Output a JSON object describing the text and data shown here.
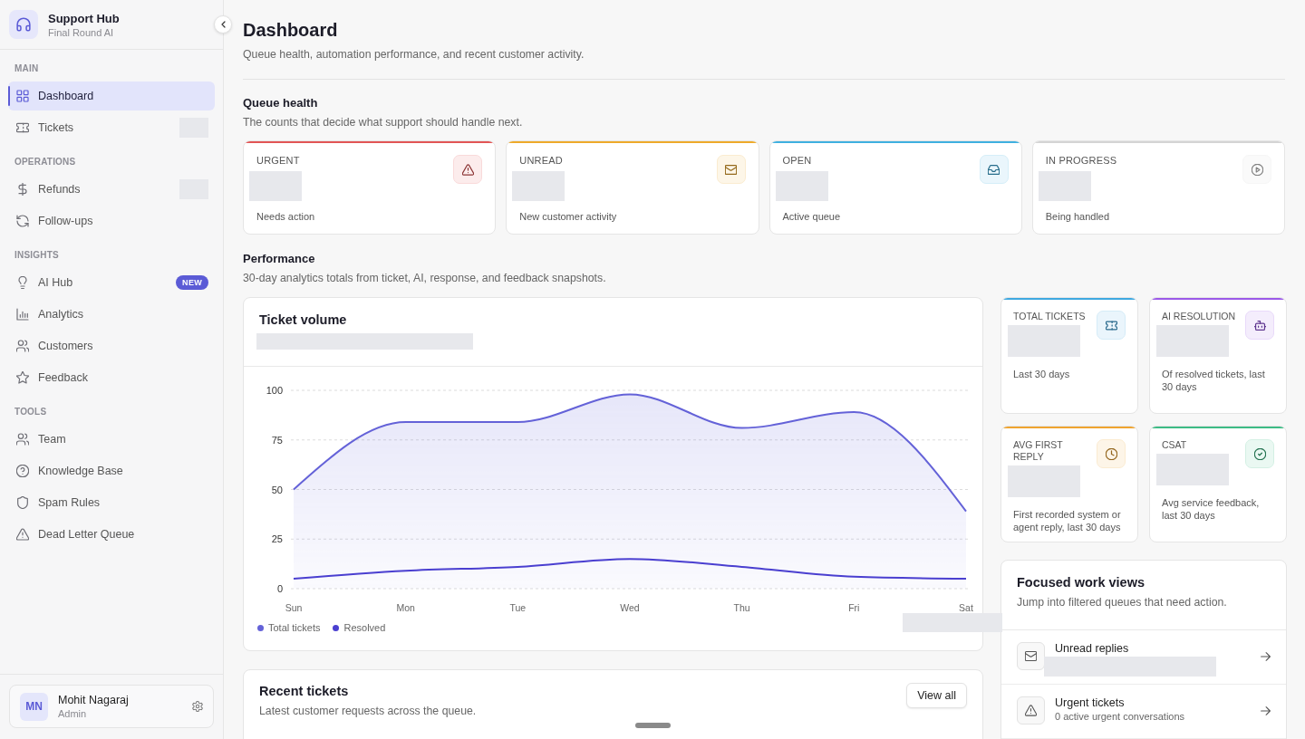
{
  "sidebar": {
    "brand": {
      "title": "Support Hub",
      "subtitle": "Final Round AI"
    },
    "sections": [
      {
        "label": "MAIN",
        "items": [
          {
            "label": "Dashboard",
            "selected": true,
            "loading": false
          },
          {
            "label": "Tickets",
            "selected": false,
            "loading": true
          }
        ]
      },
      {
        "label": "OPERATIONS",
        "items": [
          {
            "label": "Refunds",
            "selected": false,
            "loading": true
          },
          {
            "label": "Follow-ups",
            "selected": false,
            "loading": false
          }
        ]
      },
      {
        "label": "INSIGHTS",
        "items": [
          {
            "label": "AI Hub",
            "selected": false,
            "loading": false,
            "badge": "NEW"
          },
          {
            "label": "Analytics",
            "selected": false,
            "loading": false
          },
          {
            "label": "Customers",
            "selected": false,
            "loading": false
          },
          {
            "label": "Feedback",
            "selected": false,
            "loading": false
          }
        ]
      },
      {
        "label": "TOOLS",
        "items": [
          {
            "label": "Team",
            "selected": false,
            "loading": false
          },
          {
            "label": "Knowledge Base",
            "selected": false,
            "loading": false
          },
          {
            "label": "Spam Rules",
            "selected": false,
            "loading": false
          },
          {
            "label": "Dead Letter Queue",
            "selected": false,
            "loading": false
          }
        ]
      }
    ],
    "user": {
      "initials": "MN",
      "name": "Mohit Nagaraj",
      "role": "Admin"
    }
  },
  "header": {
    "title": "Dashboard",
    "subtitle": "Queue health, automation performance, and recent customer activity."
  },
  "queue_health": {
    "title": "Queue health",
    "description": "The counts that decide what support should handle next.",
    "cards": [
      {
        "label": "URGENT",
        "caption": "Needs action",
        "color": "#e25555",
        "loading": true
      },
      {
        "label": "UNREAD",
        "caption": "New customer activity",
        "color": "#eeaa2a",
        "loading": true
      },
      {
        "label": "OPEN",
        "caption": "Active queue",
        "color": "#3fb0e0",
        "loading": true
      },
      {
        "label": "IN PROGRESS",
        "caption": "Being handled",
        "color": "#d4d4d4",
        "loading": true
      }
    ]
  },
  "performance": {
    "title": "Performance",
    "description": "30-day analytics totals from ticket, AI, response, and feedback snapshots.",
    "chart": {
      "subtitle_loading": true,
      "tooltip_loading": true,
      "chart_data": {
        "type": "line",
        "title": "Ticket volume",
        "categories": [
          "Sun",
          "Mon",
          "Tue",
          "Wed",
          "Thu",
          "Fri",
          "Sat"
        ],
        "series": [
          {
            "name": "Total tickets",
            "type": "area",
            "color": "#6462d8",
            "values": [
              50,
              84,
              84,
              98,
              81,
              89,
              39
            ]
          },
          {
            "name": "Resolved",
            "type": "line",
            "color": "#4a3fd0",
            "values": [
              5,
              9,
              11,
              15,
              11,
              6,
              5
            ]
          }
        ],
        "ylim": [
          0,
          100
        ],
        "yticks": [
          0,
          25,
          50,
          75,
          100
        ],
        "grid": true,
        "legend": "bottom"
      }
    },
    "metrics": [
      {
        "label": "TOTAL TICKETS",
        "caption": "Last 30 days",
        "color": "#3fa8e0",
        "loading": true
      },
      {
        "label": "AI RESOLUTION",
        "caption": "Of resolved tickets, last 30 days",
        "color": "#9b59e8",
        "loading": true
      },
      {
        "label": "AVG FIRST REPLY",
        "caption": "First recorded system or agent reply, last 30 days",
        "color": "#efa430",
        "loading": true
      },
      {
        "label": "CSAT",
        "caption": "Avg service feedback, last 30 days",
        "color": "#3dbb85",
        "loading": true
      }
    ]
  },
  "focused_views": {
    "title": "Focused work views",
    "description": "Jump into filtered queues that need action.",
    "items": [
      {
        "title": "Unread replies",
        "loading": true
      },
      {
        "title": "Urgent tickets",
        "subtitle": "0 active urgent conversations",
        "loading": false
      }
    ]
  },
  "recent_tickets": {
    "title": "Recent tickets",
    "description": "Latest customer requests across the queue.",
    "action": "View all"
  }
}
